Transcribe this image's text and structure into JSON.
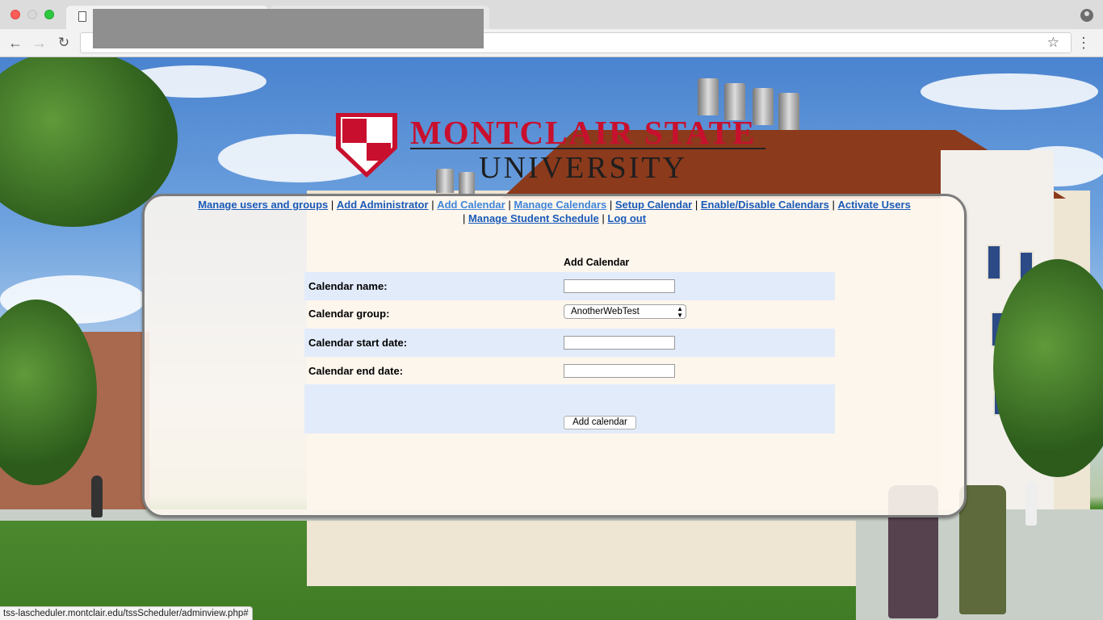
{
  "browser": {
    "url_status": "tss-lascheduler.montclair.edu/tssScheduler/adminview.php#"
  },
  "logo": {
    "line1": "MONTCLAIR STATE",
    "line2": "UNIVERSITY"
  },
  "nav": {
    "links": [
      "Manage users and groups",
      "Add Administrator",
      "Add Calendar",
      "Manage Calendars",
      "Setup Calendar",
      "Enable/Disable Calendars",
      "Activate Users",
      "Manage Student Schedule",
      "Log out"
    ],
    "separator": "|"
  },
  "form": {
    "title": "Add Calendar",
    "name_label": "Calendar name:",
    "group_label": "Calendar group:",
    "group_selected": "AnotherWebTest",
    "start_label": "Calendar start date:",
    "end_label": "Calendar end date:",
    "submit_label": "Add calendar"
  },
  "colors": {
    "brand_red": "#c8102e",
    "link": "#1a5ab8",
    "link_current": "#3e85d8",
    "row_shade": "#e2ebfa"
  }
}
